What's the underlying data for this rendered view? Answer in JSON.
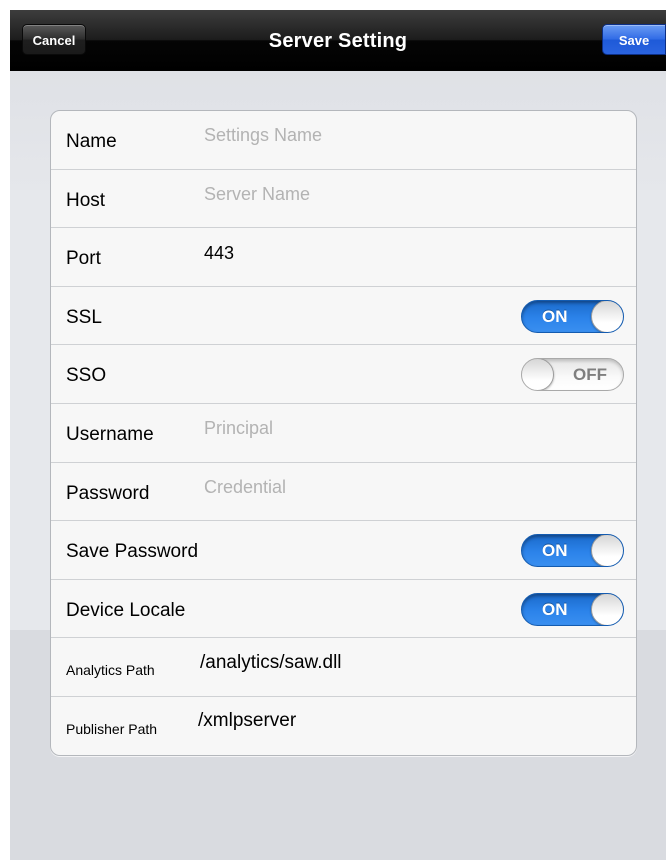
{
  "navbar": {
    "title": "Server Setting",
    "cancel_label": "Cancel",
    "save_label": "Save"
  },
  "form": {
    "rows": [
      {
        "label": "Name",
        "placeholder": "Settings Name",
        "value": ""
      },
      {
        "label": "Host",
        "placeholder": "Server Name",
        "value": ""
      },
      {
        "label": "Port",
        "value": "443"
      },
      {
        "label": "SSL",
        "toggle": true,
        "state": "ON"
      },
      {
        "label": "SSO",
        "toggle": true,
        "state": "OFF"
      },
      {
        "label": "Username",
        "placeholder": "Principal",
        "value": ""
      },
      {
        "label": "Password",
        "placeholder": "Credential",
        "value": ""
      },
      {
        "label": "Save Password",
        "toggle": true,
        "state": "ON"
      },
      {
        "label": "Device Locale",
        "toggle": true,
        "state": "ON"
      },
      {
        "label": "Analytics Path",
        "value": "/analytics/saw.dll"
      },
      {
        "label": "Publisher Path",
        "value": "/xmlpserver"
      }
    ]
  },
  "colors": {
    "toggle_on": "#2b83ea",
    "save_button": "#2f6ae6",
    "navbar": "#1c1c1c"
  }
}
